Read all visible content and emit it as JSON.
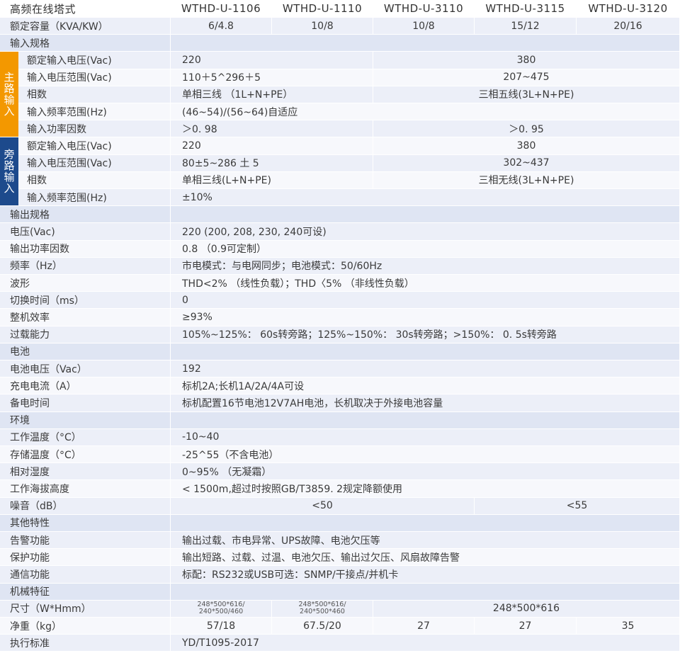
{
  "colors": {
    "row_alt": "#eceff8",
    "row_plain": "#f7f8fc",
    "section": "#dfe5f3",
    "main_input": "#f39800",
    "bypass_input": "#1d4a8c",
    "border": "#ffffff"
  },
  "header": {
    "title": "高频在线塔式",
    "models": [
      "WTHD-U-1106",
      "WTHD-U-1110",
      "WTHD-U-3110",
      "WTHD-U-3115",
      "WTHD-U-3120"
    ]
  },
  "side_labels": {
    "main": "主路输入",
    "bypass": "旁路输入"
  },
  "rows": [
    {
      "label": "额定容量（KVA/KW）",
      "cells": [
        [
          "6/4.8",
          1,
          "c"
        ],
        [
          "10/8",
          1,
          "c"
        ],
        [
          "10/8",
          1,
          "c"
        ],
        [
          "15/12",
          1,
          "c"
        ],
        [
          "20/16",
          1,
          "c"
        ]
      ]
    },
    {
      "label": "输入规格",
      "section": true,
      "cells": []
    },
    {
      "label": "额定输入电压(Vac)",
      "group": "main",
      "cells": [
        [
          "220",
          2,
          "l"
        ],
        [
          "380",
          3,
          "c"
        ]
      ]
    },
    {
      "label": "输入电压范围(Vac)",
      "group": "main",
      "cells": [
        [
          "110＋5^296＋5",
          2,
          "l"
        ],
        [
          "207~475",
          3,
          "c"
        ]
      ]
    },
    {
      "label": "相数",
      "group": "main",
      "cells": [
        [
          "单相三线 （1L+N+PE）",
          2,
          "l"
        ],
        [
          "三相五线(3L+N+PE)",
          3,
          "c"
        ]
      ]
    },
    {
      "label": "输入频率范围(Hz)",
      "group": "main",
      "cells": [
        [
          "(46~54)/(56~64)自适应",
          5,
          "l"
        ]
      ]
    },
    {
      "label": "输入功率因数",
      "group": "main",
      "cells": [
        [
          "＞0. 98",
          2,
          "l"
        ],
        [
          "＞0. 95",
          3,
          "c"
        ]
      ]
    },
    {
      "label": "额定输入电压(Vac)",
      "group": "bypass",
      "cells": [
        [
          "220",
          2,
          "l"
        ],
        [
          "380",
          3,
          "c"
        ]
      ]
    },
    {
      "label": "输入电压范围(Vac)",
      "group": "bypass",
      "cells": [
        [
          "80±5~286 土 5",
          2,
          "l"
        ],
        [
          "302~437",
          3,
          "c"
        ]
      ]
    },
    {
      "label": "相数",
      "group": "bypass",
      "cells": [
        [
          "单相三线(L+N+PE)",
          2,
          "l"
        ],
        [
          "三相无线(3L+N+PE)",
          3,
          "c"
        ]
      ]
    },
    {
      "label": "输入频率范围(Hz)",
      "group": "bypass",
      "cells": [
        [
          "±10%",
          5,
          "l"
        ]
      ]
    },
    {
      "label": "输出规格",
      "section": true,
      "cells": []
    },
    {
      "label": "电压(Vac)",
      "cells": [
        [
          "220 (200, 208, 230, 240可设)",
          5,
          "l"
        ]
      ]
    },
    {
      "label": "输出功率因数",
      "cells": [
        [
          "0.8 （0.9可定制）",
          5,
          "l"
        ]
      ]
    },
    {
      "label": "频率（Hz）",
      "cells": [
        [
          "市电模式：与电网同步；电池模式：50/60Hz",
          5,
          "l"
        ]
      ]
    },
    {
      "label": "波形",
      "cells": [
        [
          "THD<2% （线性负载）；THD〈5% （非线性负载）",
          5,
          "l"
        ]
      ]
    },
    {
      "label": "切换时间（ms）",
      "cells": [
        [
          "0",
          5,
          "l"
        ]
      ]
    },
    {
      "label": "整机效率",
      "cells": [
        [
          "≥93%",
          5,
          "l"
        ]
      ]
    },
    {
      "label": "过载能力",
      "cells": [
        [
          "105%~125%： 60s转旁路；125%~150%： 30s转旁路；>150%： 0. 5s转旁路",
          5,
          "l"
        ]
      ]
    },
    {
      "label": "电池",
      "section": true,
      "cells": []
    },
    {
      "label": "电池电压（Vac）",
      "cells": [
        [
          "192",
          5,
          "l"
        ]
      ]
    },
    {
      "label": "充电电流（A）",
      "cells": [
        [
          "标机2A;长机1A/2A/4A可设",
          5,
          "l"
        ]
      ]
    },
    {
      "label": "备电时间",
      "cells": [
        [
          "标机配置16节电池12V7AH电池，长机取决于外接电池容量",
          5,
          "l"
        ]
      ]
    },
    {
      "label": "环境",
      "section": true,
      "cells": []
    },
    {
      "label": "工作温度（°C）",
      "cells": [
        [
          "-10~40",
          5,
          "l"
        ]
      ]
    },
    {
      "label": "存储温度（°C）",
      "cells": [
        [
          "-25^55（不含电池）",
          5,
          "l"
        ]
      ]
    },
    {
      "label": "相对湿度",
      "cells": [
        [
          "0~95% （无凝霜）",
          5,
          "l"
        ]
      ]
    },
    {
      "label": "工作海拔高度",
      "cells": [
        [
          "< 1500m,超过时按照GB/T3859. 2规定降额使用",
          5,
          "l"
        ]
      ]
    },
    {
      "label": "噪音（dB）",
      "cells": [
        [
          "<50",
          3,
          "c"
        ],
        [
          "<55",
          2,
          "c"
        ]
      ]
    },
    {
      "label": "其他特性",
      "section": true,
      "cells": []
    },
    {
      "label": "告警功能",
      "cells": [
        [
          "输出过载、市电异常、UPS故障、电池欠压等",
          5,
          "l"
        ]
      ]
    },
    {
      "label": "保护功能",
      "cells": [
        [
          "输出短路、过载、过温、电池欠压、输出过欠压、风扇故障告警",
          5,
          "l"
        ]
      ]
    },
    {
      "label": "通信功能",
      "cells": [
        [
          "标配：RS232或USB可选：SNMP/干接点/并机卡",
          5,
          "l"
        ]
      ]
    },
    {
      "label": "机械特征",
      "section": true,
      "cells": []
    },
    {
      "label": "尺寸（W*Hmm）",
      "cells": [
        [
          "248*500*616/\n240*500/460",
          1,
          "small"
        ],
        [
          "248*500*616/\n240*500*460",
          1,
          "small"
        ],
        [
          "248*500*616",
          3,
          "c"
        ]
      ]
    },
    {
      "label": "净重（kg）",
      "cells": [
        [
          "57/18",
          1,
          "c"
        ],
        [
          "67.5/20",
          1,
          "c"
        ],
        [
          "27",
          1,
          "c"
        ],
        [
          "27",
          1,
          "c"
        ],
        [
          "35",
          1,
          "c"
        ]
      ]
    },
    {
      "label": "执行标准",
      "cells": [
        [
          "YD/T1095-2017",
          5,
          "l"
        ]
      ]
    }
  ]
}
